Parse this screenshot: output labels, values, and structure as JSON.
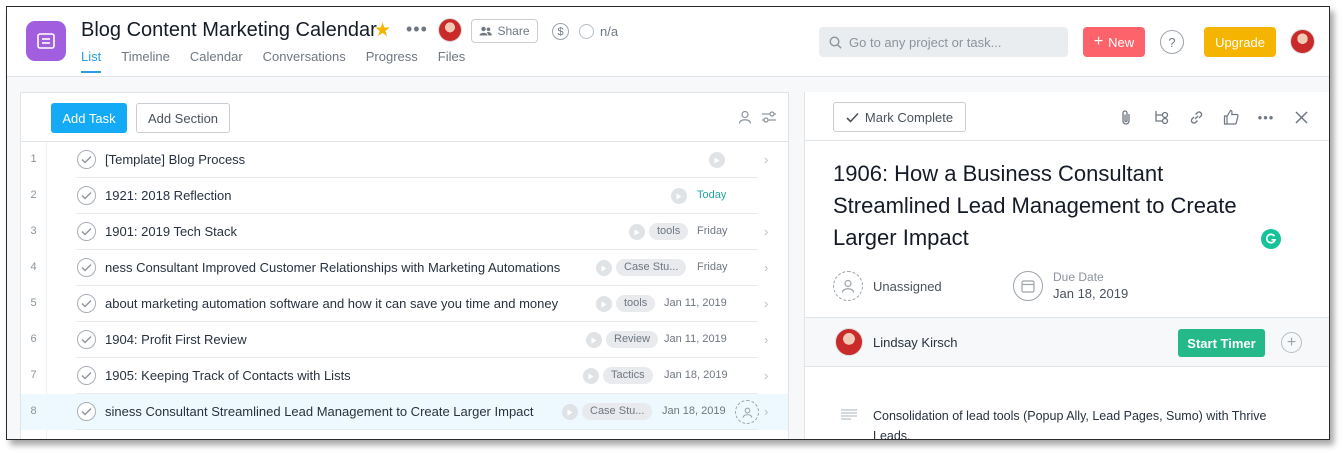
{
  "project": {
    "title": "Blog Content Marketing Calendar",
    "status_text": "n/a"
  },
  "header": {
    "share_label": "Share",
    "dollar_symbol": "$",
    "search_placeholder": "Go to any project or task...",
    "new_label": "New",
    "help_symbol": "?",
    "upgrade_label": "Upgrade"
  },
  "tabs": [
    "List",
    "Timeline",
    "Calendar",
    "Conversations",
    "Progress",
    "Files"
  ],
  "list": {
    "add_task_label": "Add Task",
    "add_section_label": "Add Section",
    "rows": [
      {
        "num": "1",
        "name": "[Template] Blog Process",
        "tag": "",
        "due": ""
      },
      {
        "num": "2",
        "name": "1921: 2018 Reflection",
        "tag": "",
        "due": "Today"
      },
      {
        "num": "3",
        "name": "1901: 2019 Tech Stack",
        "tag": "tools",
        "due": "Friday"
      },
      {
        "num": "4",
        "name": "ness Consultant Improved Customer Relationships with Marketing Automations",
        "tag": "Case Stu...",
        "due": "Friday"
      },
      {
        "num": "5",
        "name": "about marketing automation software and how it can save you time and money",
        "tag": "tools",
        "due": "Jan 11, 2019"
      },
      {
        "num": "6",
        "name": "1904: Profit First Review",
        "tag": "Review",
        "due": "Jan 11, 2019"
      },
      {
        "num": "7",
        "name": "1905: Keeping Track of Contacts with Lists",
        "tag": "Tactics",
        "due": "Jan 18, 2019"
      },
      {
        "num": "8",
        "name": "siness Consultant Streamlined Lead Management to Create Larger Impact",
        "tag": "Case Stu...",
        "due": "Jan 18, 2019"
      }
    ]
  },
  "detail": {
    "mark_complete_label": "Mark Complete",
    "title": "1906: How a Business Consultant Streamlined Lead Management to Create Larger Impact",
    "assignee": "Unassigned",
    "due_label": "Due Date",
    "due_value": "Jan 18, 2019",
    "timer_user": "Lindsay Kirsch",
    "start_timer_label": "Start Timer",
    "description": "Consolidation of lead tools (Popup Ally, Lead Pages, Sumo) with Thrive Leads."
  },
  "colors": {
    "accent": "#14aaf5",
    "new": "#fc636b",
    "upgrade": "#f5b400",
    "timer": "#25b98a",
    "project_icon": "#a15fdf"
  }
}
